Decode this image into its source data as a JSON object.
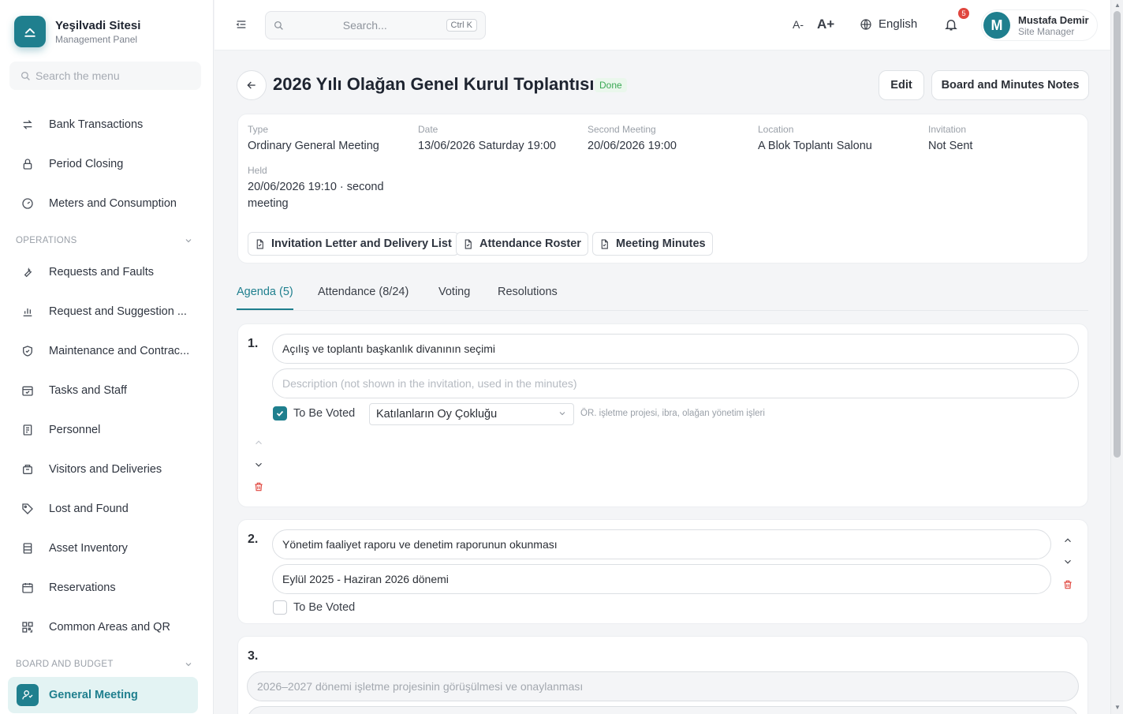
{
  "brand": {
    "title": "Yeşilvadi Sitesi",
    "subtitle": "Management Panel"
  },
  "sidebar": {
    "search_placeholder": "Search the menu",
    "items_top": [
      {
        "label": "Bank Transactions",
        "icon": "transfer-icon"
      },
      {
        "label": "Period Closing",
        "icon": "lock-icon"
      },
      {
        "label": "Meters and Consumption",
        "icon": "gauge-icon"
      }
    ],
    "section_operations": "OPERATIONS",
    "items_operations": [
      {
        "label": "Requests and Faults",
        "icon": "wrench-icon"
      },
      {
        "label": "Request and Suggestion ...",
        "icon": "bar-chart-icon"
      },
      {
        "label": "Maintenance and Contrac...",
        "icon": "shield-check-icon"
      },
      {
        "label": "Tasks and Staff",
        "icon": "calendar-check-icon"
      },
      {
        "label": "Personnel",
        "icon": "id-card-icon"
      },
      {
        "label": "Visitors and Deliveries",
        "icon": "package-icon"
      },
      {
        "label": "Lost and Found",
        "icon": "tag-icon"
      },
      {
        "label": "Asset Inventory",
        "icon": "cabinet-icon"
      },
      {
        "label": "Reservations",
        "icon": "calendar-icon"
      },
      {
        "label": "Common Areas and QR",
        "icon": "qr-icon"
      }
    ],
    "section_board": "BOARD AND BUDGET",
    "active_item": {
      "label": "General Meeting",
      "icon": "people-icon"
    }
  },
  "topbar": {
    "search_placeholder": "Search...",
    "shortcut": "Ctrl K",
    "font_decrease": "A-",
    "font_increase": "A+",
    "language": "English",
    "notification_count": "5",
    "user": {
      "initial": "M",
      "name": "Mustafa Demir",
      "role": "Site Manager"
    }
  },
  "header": {
    "title": "2026 Yılı Olağan Genel Kurul Toplantısı",
    "status": "Done",
    "edit_label": "Edit",
    "notes_label": "Board and Minutes Notes"
  },
  "info": {
    "type_label": "Type",
    "type_value": "Ordinary General Meeting",
    "date_label": "Date",
    "date_value": "13/06/2026 Saturday 19:00",
    "second_label": "Second Meeting",
    "second_value": "20/06/2026 19:00",
    "location_label": "Location",
    "location_value": "A Blok Toplantı Salonu",
    "invitation_label": "Invitation",
    "invitation_value": "Not Sent",
    "held_label": "Held",
    "held_value": "20/06/2026 19:10 · second meeting",
    "docs": [
      "Invitation Letter and Delivery List",
      "Attendance Roster",
      "Meeting Minutes"
    ]
  },
  "tabs": [
    "Agenda (5)",
    "Attendance (8/24)",
    "Voting",
    "Resolutions"
  ],
  "agenda": [
    {
      "number": "1.",
      "title": "Açılış ve toplantı başkanlık divanının seçimi",
      "description_placeholder": "Description (not shown in the invitation, used in the minutes)",
      "to_be_voted_label": "To Be Voted",
      "to_be_voted": true,
      "majority": "Katılanların Oy Çokluğu",
      "hint": "ÖR. işletme projesi, ibra, olağan yönetim işleri"
    },
    {
      "number": "2.",
      "title": "Yönetim faaliyet raporu ve denetim raporunun okunması",
      "description": "Eylül 2025 - Haziran 2026 dönemi",
      "to_be_voted_label": "To Be Voted",
      "to_be_voted": false
    },
    {
      "number": "3.",
      "title": "2026–2027 dönemi işletme projesinin görüşülmesi ve onaylanması"
    }
  ],
  "colors": {
    "accent": "#1f7f8e",
    "done": "#3aa854",
    "danger": "#e0463e"
  }
}
